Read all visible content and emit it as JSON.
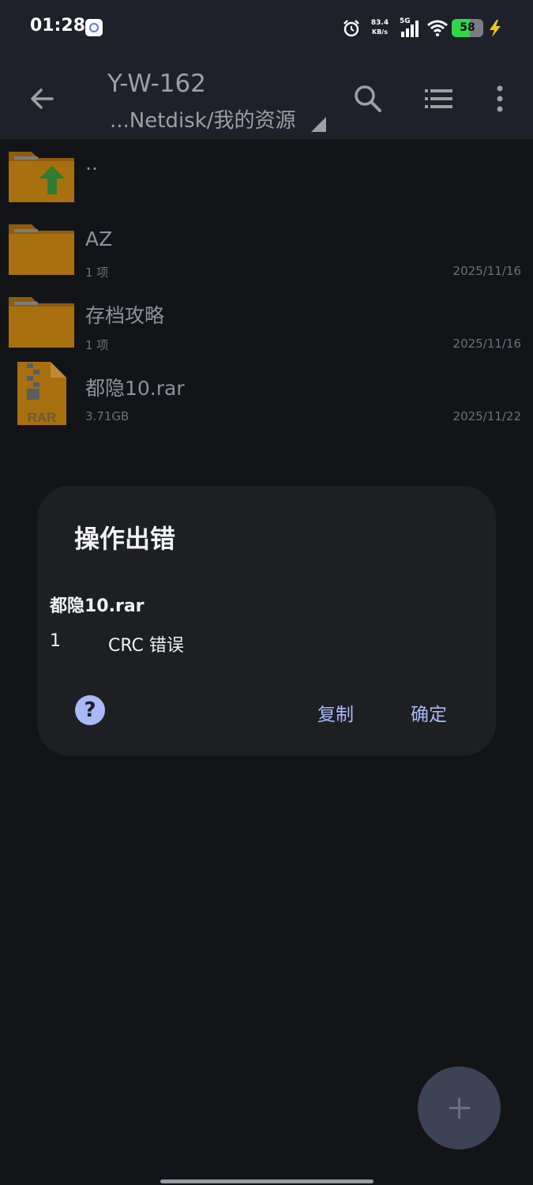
{
  "status_bar": {
    "time": "01:28",
    "net_speed_value": "83.4",
    "net_speed_unit": "KB/s",
    "network_type": "5G",
    "battery_level": 58,
    "battery_label": "58",
    "charging": true
  },
  "toolbar": {
    "title": "Y-W-162",
    "path": "...Netdisk/我的资源",
    "icons": [
      "back-arrow-icon",
      "search-icon",
      "list-view-icon",
      "more-vert-icon"
    ]
  },
  "files": [
    {
      "name": "..",
      "sub": "",
      "date": "",
      "icon": "parent-folder-icon"
    },
    {
      "name": "AZ",
      "sub": "1 项",
      "date": "2025/11/16",
      "icon": "folder-icon"
    },
    {
      "name": "存档攻略",
      "sub": "1 项",
      "date": "2025/11/16",
      "icon": "folder-icon"
    },
    {
      "name": "都隐10.rar",
      "sub": "3.71GB",
      "date": "2025/11/22",
      "icon": "rar-file-icon"
    }
  ],
  "rar_badge": "RAR",
  "dialog": {
    "title": "操作出错",
    "file_name": "都隐10.rar",
    "error_index": "1",
    "error_message": "CRC 错误",
    "help_symbol": "?",
    "copy_label": "复制",
    "ok_label": "确定"
  },
  "fab_icon": "plus-icon",
  "colors": {
    "toolbar_bg": "#1e2129",
    "page_bg": "#131417",
    "dialog_bg": "#1e1f23",
    "accent": "#a9b8f7",
    "folder": "#d48a12",
    "battery_green": "#31d64a"
  }
}
